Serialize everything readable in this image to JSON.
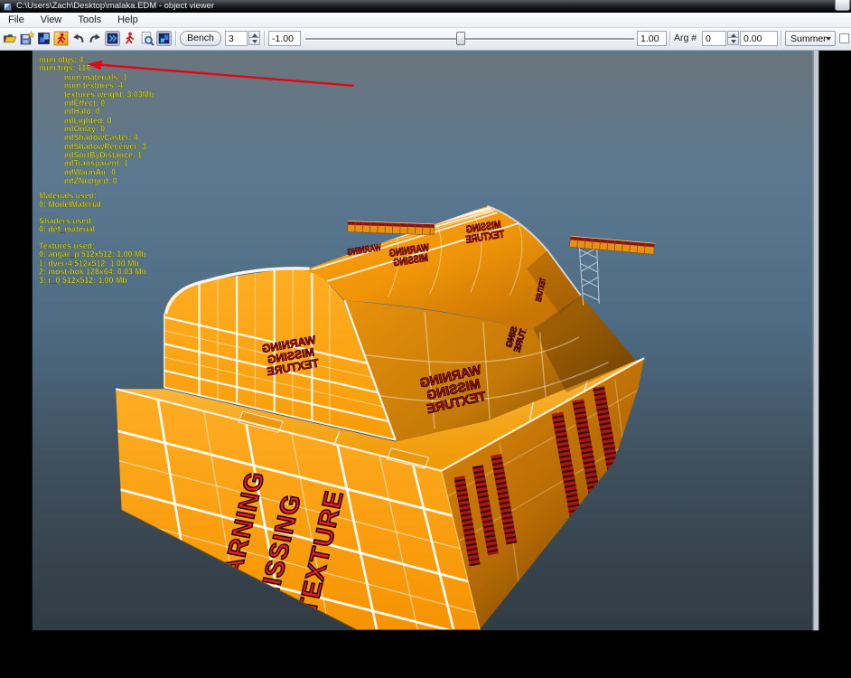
{
  "window": {
    "title": "C:\\Users\\Zach\\Desktop\\malaka.EDM - object viewer"
  },
  "menu": {
    "items": [
      "File",
      "View",
      "Tools",
      "Help"
    ]
  },
  "toolbar": {
    "icons": [
      "open-folder",
      "save-as",
      "copy-model",
      "run-model",
      "undo",
      "redo",
      "fast-forward",
      "animate",
      "zoom-page",
      "texture-info"
    ],
    "bench_label": "Bench",
    "bench_value": "3",
    "speed_value": "-1.00",
    "slider_value": "1.00",
    "slider_handle_style": "left:167px",
    "arg_label": "Arg #",
    "arg_value": "0",
    "arg_float_value": "0.00",
    "season_value": "Summer"
  },
  "viewport": {
    "debug": [
      "num objs: 4",
      "num trgs: 116",
      "num materials: 1",
      "num textures: 4",
      "textures weight: 3.03Mb",
      "mfEffect: 0",
      "mfHalo: 0",
      "mfLighted: 0",
      "mfOnlay: 0",
      "mfShadowCaster: 4",
      "mfShadowReceiver: 3",
      "mfSortByDistance: 1",
      "mfTransparent: 1",
      "mfWarmAir: 0",
      "mfZNudged: 0",
      "Materials used:",
      "0: ModelMaterial",
      "Shaders used:",
      "0: def_material",
      "Textures used:",
      "0: angar_p 512x512: 1.00 Mb",
      "1: dver-4 512x512: 1.00 Mb",
      "2: most-bok 128x64: 0.03 Mb",
      "3: r_0 512x512: 1.00 Mb"
    ],
    "debug_color": "#d6e03c",
    "annotation": {
      "type": "arrow",
      "points_at": "num trgs: 116",
      "color": "#e30613"
    },
    "warning": {
      "w1": "WARNING",
      "w2": "MISSING",
      "w3": "TEXTURE"
    },
    "model_colors": {
      "orange_bright": "#FFA81E",
      "orange_shadow": "#8A5203",
      "warning_red": "#ED1C24",
      "grid_white": "#FFFFFF"
    }
  }
}
